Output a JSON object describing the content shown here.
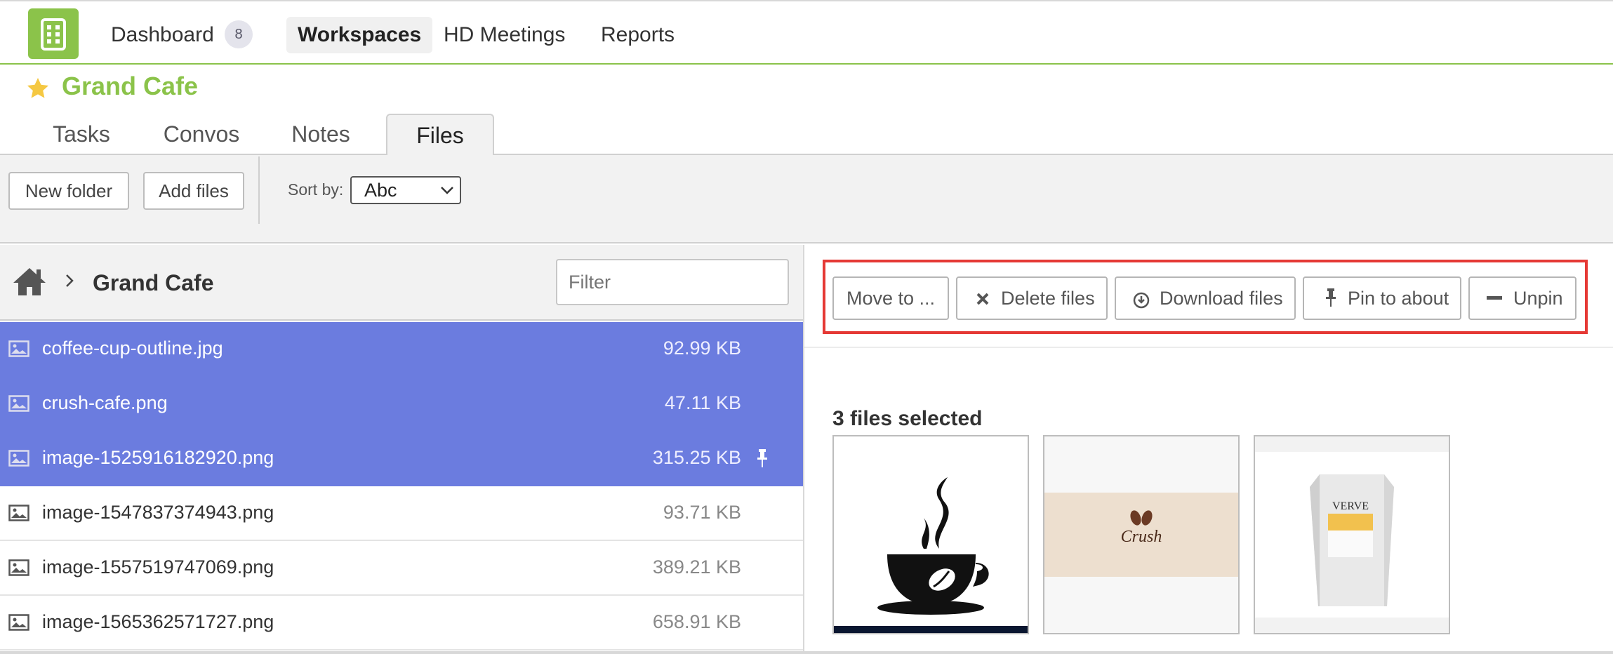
{
  "nav": {
    "items": [
      {
        "label": "Dashboard",
        "badge": "8",
        "active": false
      },
      {
        "label": "Workspaces",
        "active": true
      },
      {
        "label": "HD Meetings",
        "active": false
      },
      {
        "label": "Reports",
        "active": false
      }
    ],
    "brand_color": "#8bc34a"
  },
  "workspace": {
    "name": "Grand Cafe",
    "favorite_icon": "star-icon"
  },
  "tabs": [
    {
      "label": "Tasks",
      "active": false
    },
    {
      "label": "Convos",
      "active": false
    },
    {
      "label": "Notes",
      "active": false
    },
    {
      "label": "Files",
      "active": true
    }
  ],
  "toolbar": {
    "new_folder_label": "New folder",
    "add_files_label": "Add files",
    "sort_label": "Sort by:",
    "sort_value": "Abc"
  },
  "breadcrumb": {
    "home_icon": "home-icon",
    "current": "Grand Cafe"
  },
  "filter": {
    "placeholder": "Filter"
  },
  "files": [
    {
      "name": "coffee-cup-outline.jpg",
      "size": "92.99 KB",
      "selected": true,
      "pinned": false
    },
    {
      "name": "crush-cafe.png",
      "size": "47.11 KB",
      "selected": true,
      "pinned": false
    },
    {
      "name": "image-1525916182920.png",
      "size": "315.25 KB",
      "selected": true,
      "pinned": true
    },
    {
      "name": "image-1547837374943.png",
      "size": "93.71 KB",
      "selected": false,
      "pinned": false
    },
    {
      "name": "image-1557519747069.png",
      "size": "389.21 KB",
      "selected": false,
      "pinned": false
    },
    {
      "name": "image-1565362571727.png",
      "size": "658.91 KB",
      "selected": false,
      "pinned": false
    }
  ],
  "actions": {
    "move_label": "Move to ...",
    "delete_label": "Delete files",
    "download_label": "Download files",
    "pin_label": "Pin to about",
    "unpin_label": "Unpin",
    "highlight_color": "#e53935"
  },
  "selection": {
    "count_label": "3 files selected"
  },
  "thumbnails": {
    "crush_logo_text": "Crush",
    "verve_logo_text": "VERVE"
  },
  "colors": {
    "selected_row": "#6b7cdf"
  }
}
